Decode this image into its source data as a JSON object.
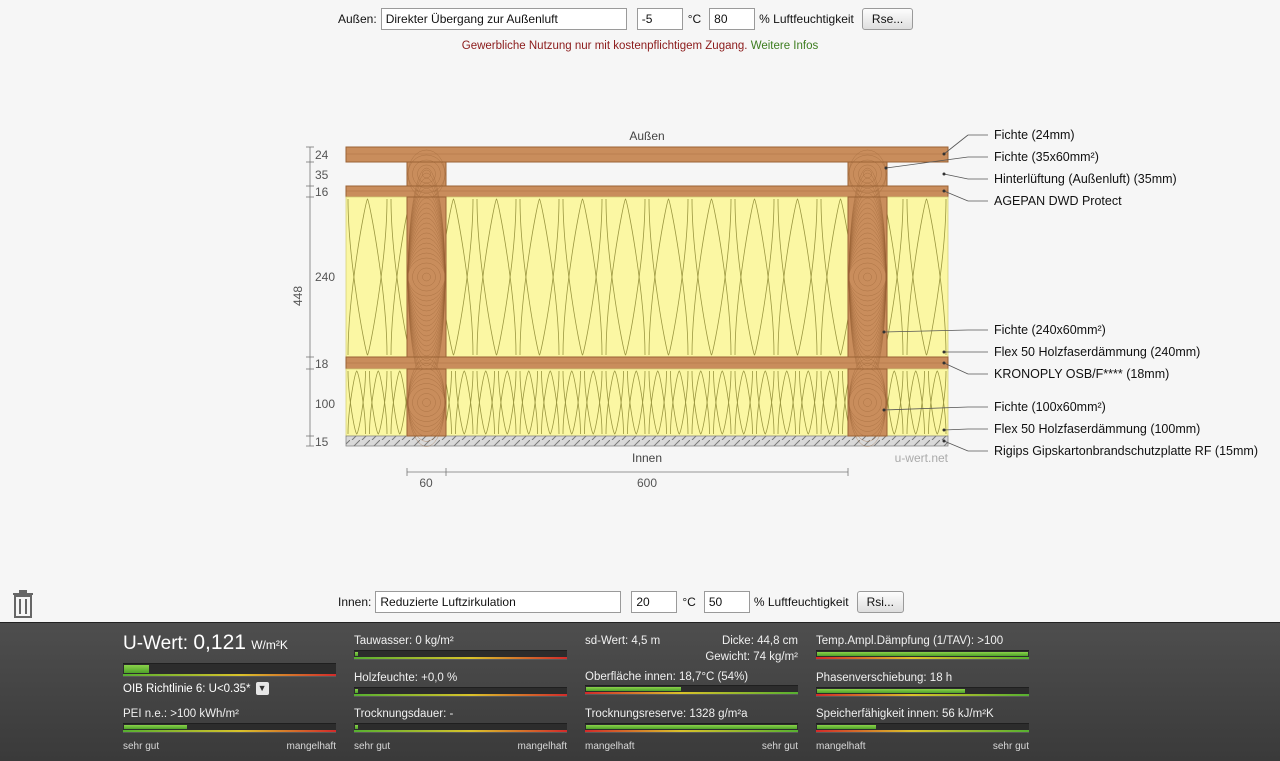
{
  "outside": {
    "label": "Außen:",
    "condition": "Direkter Übergang zur Außenluft",
    "temperature": "-5",
    "temp_unit": "°C",
    "humidity": "80",
    "humidity_unit": "% Luftfeuchtigkeit",
    "button": "Rse..."
  },
  "notice": {
    "text": "Gewerbliche Nutzung nur mit kostenpflichtigem Zugang.",
    "link": "Weitere Infos",
    "text_color": "#8b1a1a",
    "link_color": "#3d7d1f"
  },
  "diagram": {
    "label_top": "Außen",
    "label_bottom": "Innen",
    "watermark": "u-wert.net",
    "total_thickness": "448",
    "layer_dims": [
      "24",
      "35",
      "16",
      "240",
      "18",
      "100",
      "15"
    ],
    "spacing_dims": [
      "60",
      "600"
    ],
    "layers": [
      "Fichte (24mm)",
      "Fichte (35x60mm²)",
      "Hinterlüftung (Außenluft) (35mm)",
      "AGEPAN DWD Protect",
      "Fichte (240x60mm²)",
      "Flex 50 Holzfaserdämmung (240mm)",
      "KRONOPLY OSB/F**** (18mm)",
      "Fichte (100x60mm²)",
      "Flex 50 Holzfaserdämmung (100mm)",
      "Rigips Gipskartonbrandschutzplatte RF (15mm)"
    ],
    "colors": {
      "wood": "#c98d5c",
      "wood_dark": "#9a6235",
      "insulation": "#fbf7a3",
      "gypsum": "#d9d9d9"
    }
  },
  "inside": {
    "label": "Innen:",
    "condition": "Reduzierte Luftzirkulation",
    "temperature": "20",
    "temp_unit": "°C",
    "humidity": "50",
    "humidity_unit": "% Luftfeuchtigkeit",
    "button": "Rsi..."
  },
  "icons": {
    "delete": "trash-icon",
    "oib_dropdown": "triangle-down-icon"
  },
  "results": {
    "uwert": {
      "label": "U-Wert:",
      "value": "0,121",
      "unit": "W/m²K",
      "level": 0.12
    },
    "oib": {
      "label": "OIB Richtlinie 6: U<0.35*",
      "dropdown": "▼"
    },
    "pei": {
      "label": "PEI n.e.: >100 kWh/m²",
      "level": 0.3
    },
    "tauwasser": {
      "label": "Tauwasser: 0 kg/m²",
      "level": 0.0
    },
    "holzfeuchte": {
      "label": "Holzfeuchte: +0,0 %",
      "level": 0.0
    },
    "trocknungsdauer": {
      "label": "Trocknungsdauer: -",
      "level": 0.0
    },
    "sdwert": {
      "label": "sd-Wert: 4,5 m",
      "level": 0.5
    },
    "dicke": {
      "label": "Dicke: 44,8 cm"
    },
    "gewicht": {
      "label": "Gewicht: 74 kg/m²"
    },
    "oberflaeche": {
      "label": "Oberfläche innen: 18,7°C (54%)",
      "level": 0.45
    },
    "trocknungsreserve": {
      "label": "Trocknungsreserve: 1328 g/m²a",
      "level": 1.0
    },
    "tav": {
      "label": "Temp.Ampl.Dämpfung (1/TAV): >100",
      "level": 1.0
    },
    "phase": {
      "label": "Phasenverschiebung: 18 h",
      "level": 0.7
    },
    "speicher": {
      "label": "Speicherfähigkeit innen: 56 kJ/m²K",
      "level": 0.28
    },
    "scales": {
      "good": "sehr gut",
      "bad": "mangelhaft"
    }
  }
}
